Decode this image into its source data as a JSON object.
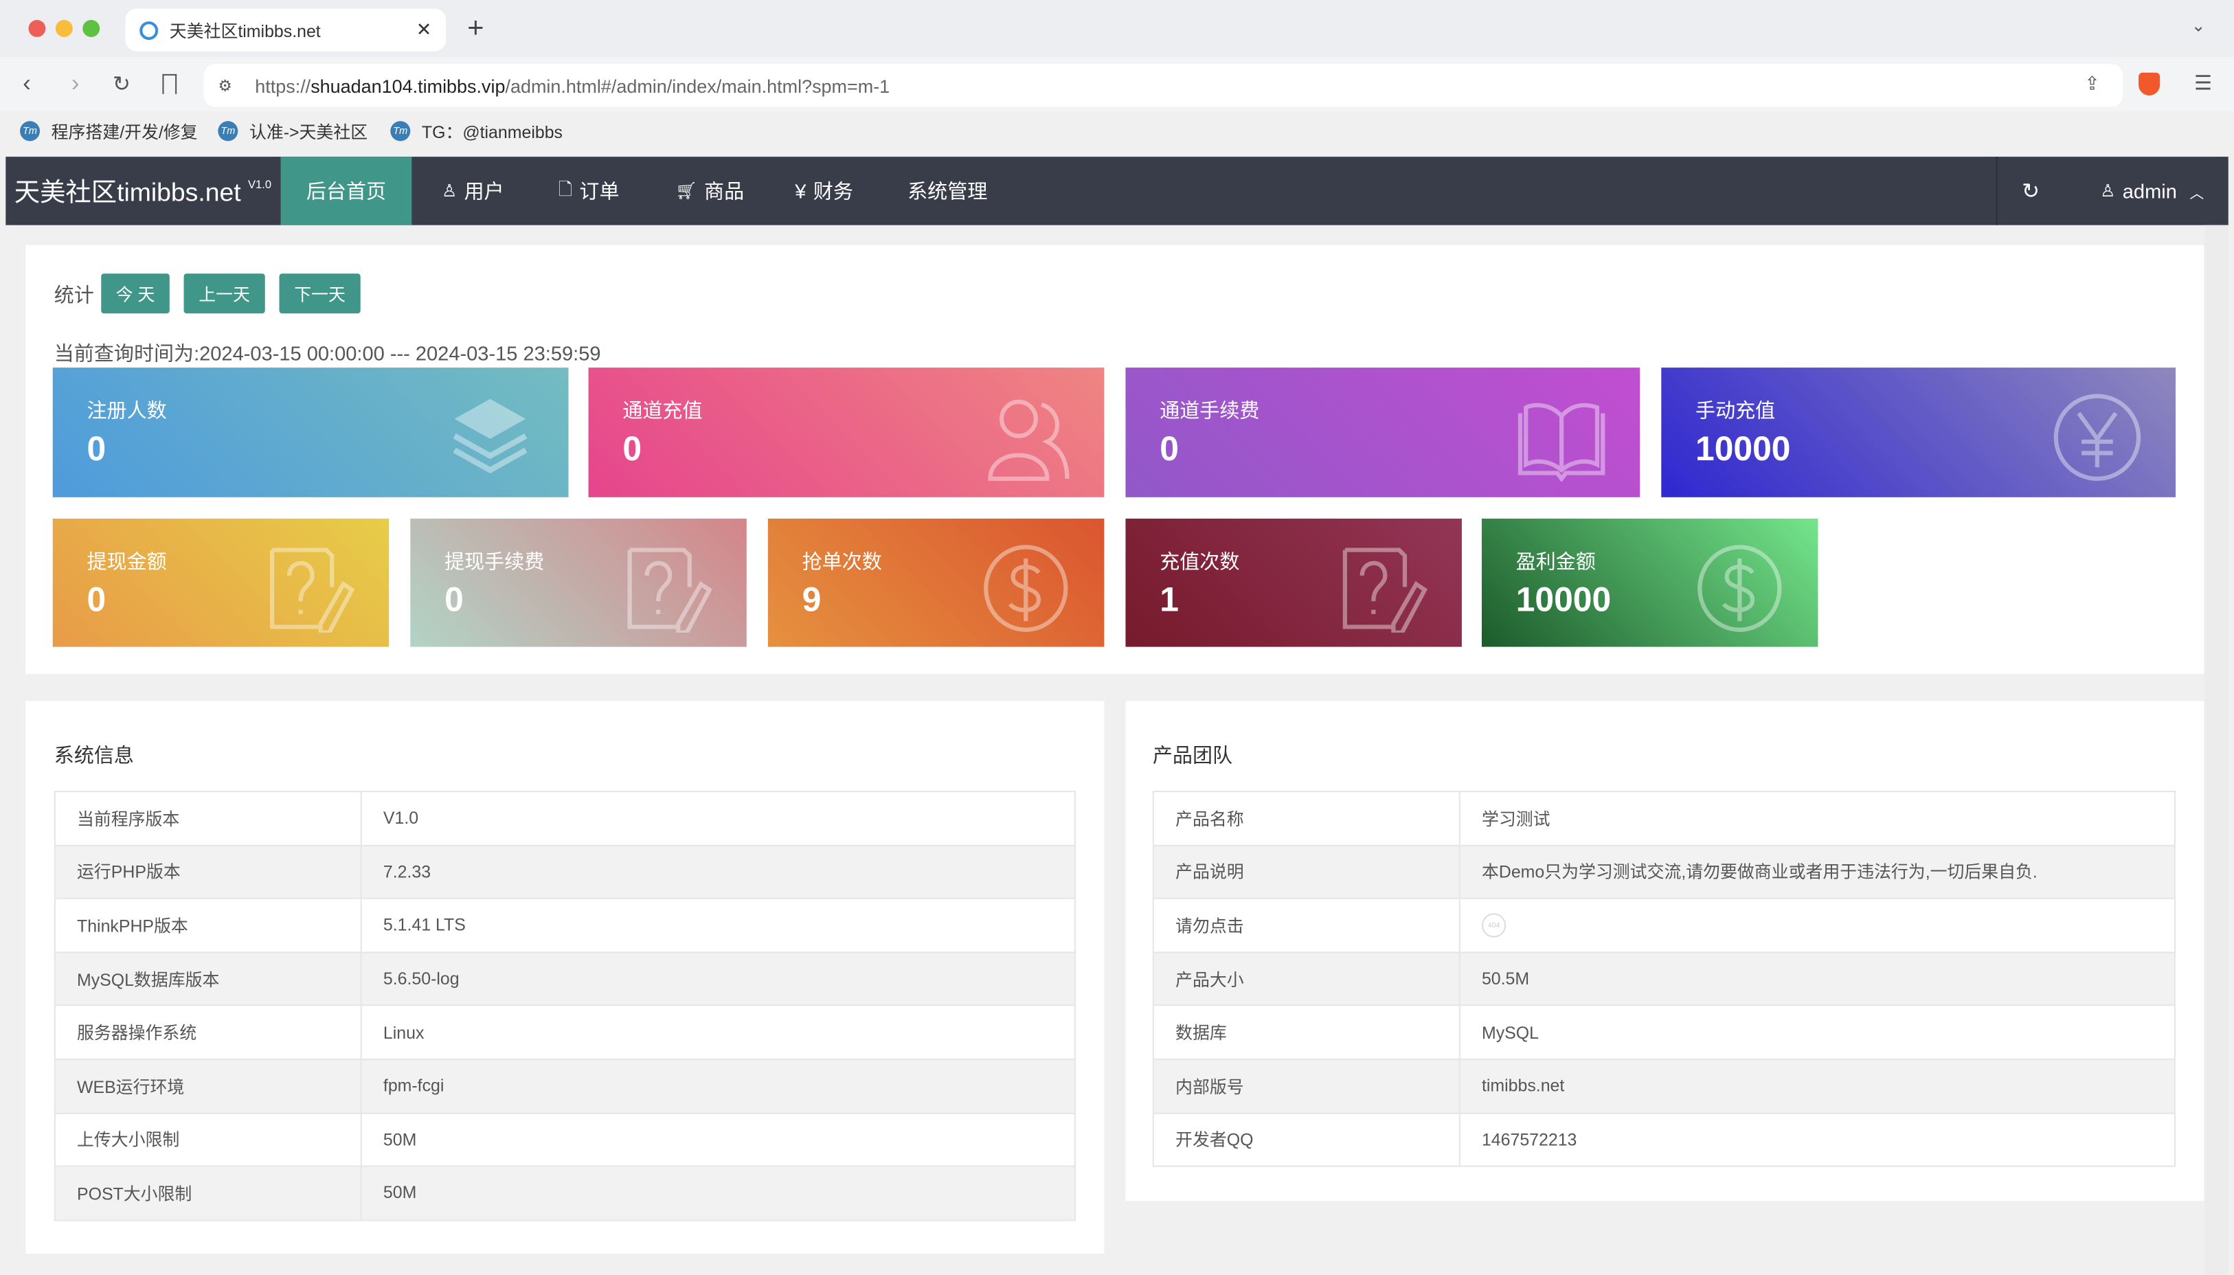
{
  "browser": {
    "tab_title": "天美社区timibbs.net",
    "url_prefix": "https://",
    "url_host": "shuadan104.timibbs.vip",
    "url_path": "/admin.html#/admin/index/main.html?spm=m-1",
    "bookmarks": [
      {
        "label": "程序搭建/开发/修复"
      },
      {
        "label": "认准->天美社区"
      },
      {
        "label": "TG：@tianmeibbs"
      }
    ]
  },
  "nav": {
    "logo": "天美社区timibbs.net",
    "version": "V1.0",
    "items": [
      {
        "label": "后台首页",
        "icon": "home",
        "active": true
      },
      {
        "label": "用户",
        "icon": "user-icon"
      },
      {
        "label": "订单",
        "icon": "file-icon"
      },
      {
        "label": "商品",
        "icon": "cart-icon"
      },
      {
        "label": "财务",
        "icon": "yen-icon"
      },
      {
        "label": "系统管理"
      }
    ],
    "user": "admin",
    "accent": "#409688"
  },
  "stats": {
    "label": "统计",
    "today": "今 天",
    "prev": "上一天",
    "next": "下一天",
    "range": "当前查询时间为:2024-03-15 00:00:00 --- 2024-03-15 23:59:59",
    "cards": [
      {
        "title": "注册人数",
        "value": "0",
        "icon": "layers-icon",
        "colors": [
          "#4e9bdc",
          "#74bcc0"
        ]
      },
      {
        "title": "通道充值",
        "value": "0",
        "icon": "users-icon",
        "colors": [
          "#e6458d",
          "#ef8582"
        ]
      },
      {
        "title": "通道手续费",
        "value": "0",
        "icon": "book-icon",
        "colors": [
          "#9158c9",
          "#c24ed0"
        ]
      },
      {
        "title": "手动充值",
        "value": "10000",
        "icon": "yen-circle-icon",
        "colors": [
          "#2f27d0",
          "#8f88bd"
        ]
      },
      {
        "title": "提现金额",
        "value": "0",
        "icon": "question-edit-icon",
        "colors": [
          "#e89b48",
          "#e7cd48"
        ]
      },
      {
        "title": "提现手续费",
        "value": "0",
        "icon": "question-edit-icon",
        "colors": [
          "#b2d4c6",
          "#d4858a"
        ]
      },
      {
        "title": "抢单次数",
        "value": "9",
        "icon": "dollar-circle-icon",
        "colors": [
          "#e5913f",
          "#db552f"
        ]
      },
      {
        "title": "充值次数",
        "value": "1",
        "icon": "question-edit-icon",
        "colors": [
          "#761a2c",
          "#933556"
        ]
      },
      {
        "title": "盈利金额",
        "value": "10000",
        "icon": "dollar-circle-icon",
        "colors": [
          "#1c5a2b",
          "#74e68c"
        ]
      }
    ]
  },
  "sysinfo": {
    "title": "系统信息",
    "rows": [
      [
        "当前程序版本",
        "V1.0"
      ],
      [
        "运行PHP版本",
        "7.2.33"
      ],
      [
        "ThinkPHP版本",
        "5.1.41 LTS"
      ],
      [
        "MySQL数据库版本",
        "5.6.50-log"
      ],
      [
        "服务器操作系统",
        "Linux"
      ],
      [
        "WEB运行环境",
        "fpm-fcgi"
      ],
      [
        "上传大小限制",
        "50M"
      ],
      [
        "POST大小限制",
        "50M"
      ]
    ]
  },
  "team": {
    "title": "产品团队",
    "rows": [
      [
        "产品名称",
        "学习测试"
      ],
      [
        "产品说明",
        "本Demo只为学习测试交流,请勿要做商业或者用于违法行为,一切后果自负."
      ],
      [
        "请勿点击",
        "404"
      ],
      [
        "产品大小",
        "50.5M"
      ],
      [
        "数据库",
        "MySQL"
      ],
      [
        "内部版号",
        "timibbs.net"
      ],
      [
        "开发者QQ",
        "1467572213"
      ]
    ]
  }
}
